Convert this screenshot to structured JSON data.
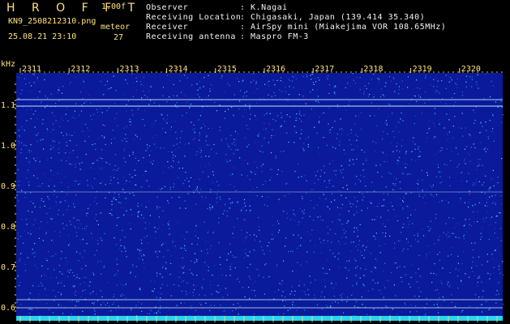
{
  "header": {
    "app_title": "H R O F F T",
    "version": "1.00f",
    "filename": "KN9_2508212310.png",
    "datetime": "25.08.21 23:10",
    "mode": "meteor",
    "count": "27",
    "info": [
      {
        "label": "Observer",
        "value": ": K.Nagai"
      },
      {
        "label": "Receiving Location",
        "value": ": Chigasaki, Japan (139.414 35.340)"
      },
      {
        "label": "Receiver",
        "value": ": AirSpy mini (Miakejima VOR 108.65MHz)"
      },
      {
        "label": "Receiving antenna",
        "value": ": Maspro FM-3"
      }
    ]
  },
  "spectrogram": {
    "y_unit": "kHz",
    "x_ticks": [
      "2311",
      "2312",
      "2313",
      "2314",
      "2315",
      "2316",
      "2317",
      "2318",
      "2319",
      "2320"
    ],
    "y_ticks": [
      "1.1",
      "1.0",
      "0.9",
      "0.8",
      "0.7",
      "0.6"
    ],
    "colors": {
      "background": "#0a1a9a",
      "text": "#ffe37a",
      "trace": "#bfe8ff",
      "bottom_bar": "#2bd4f0"
    }
  }
}
